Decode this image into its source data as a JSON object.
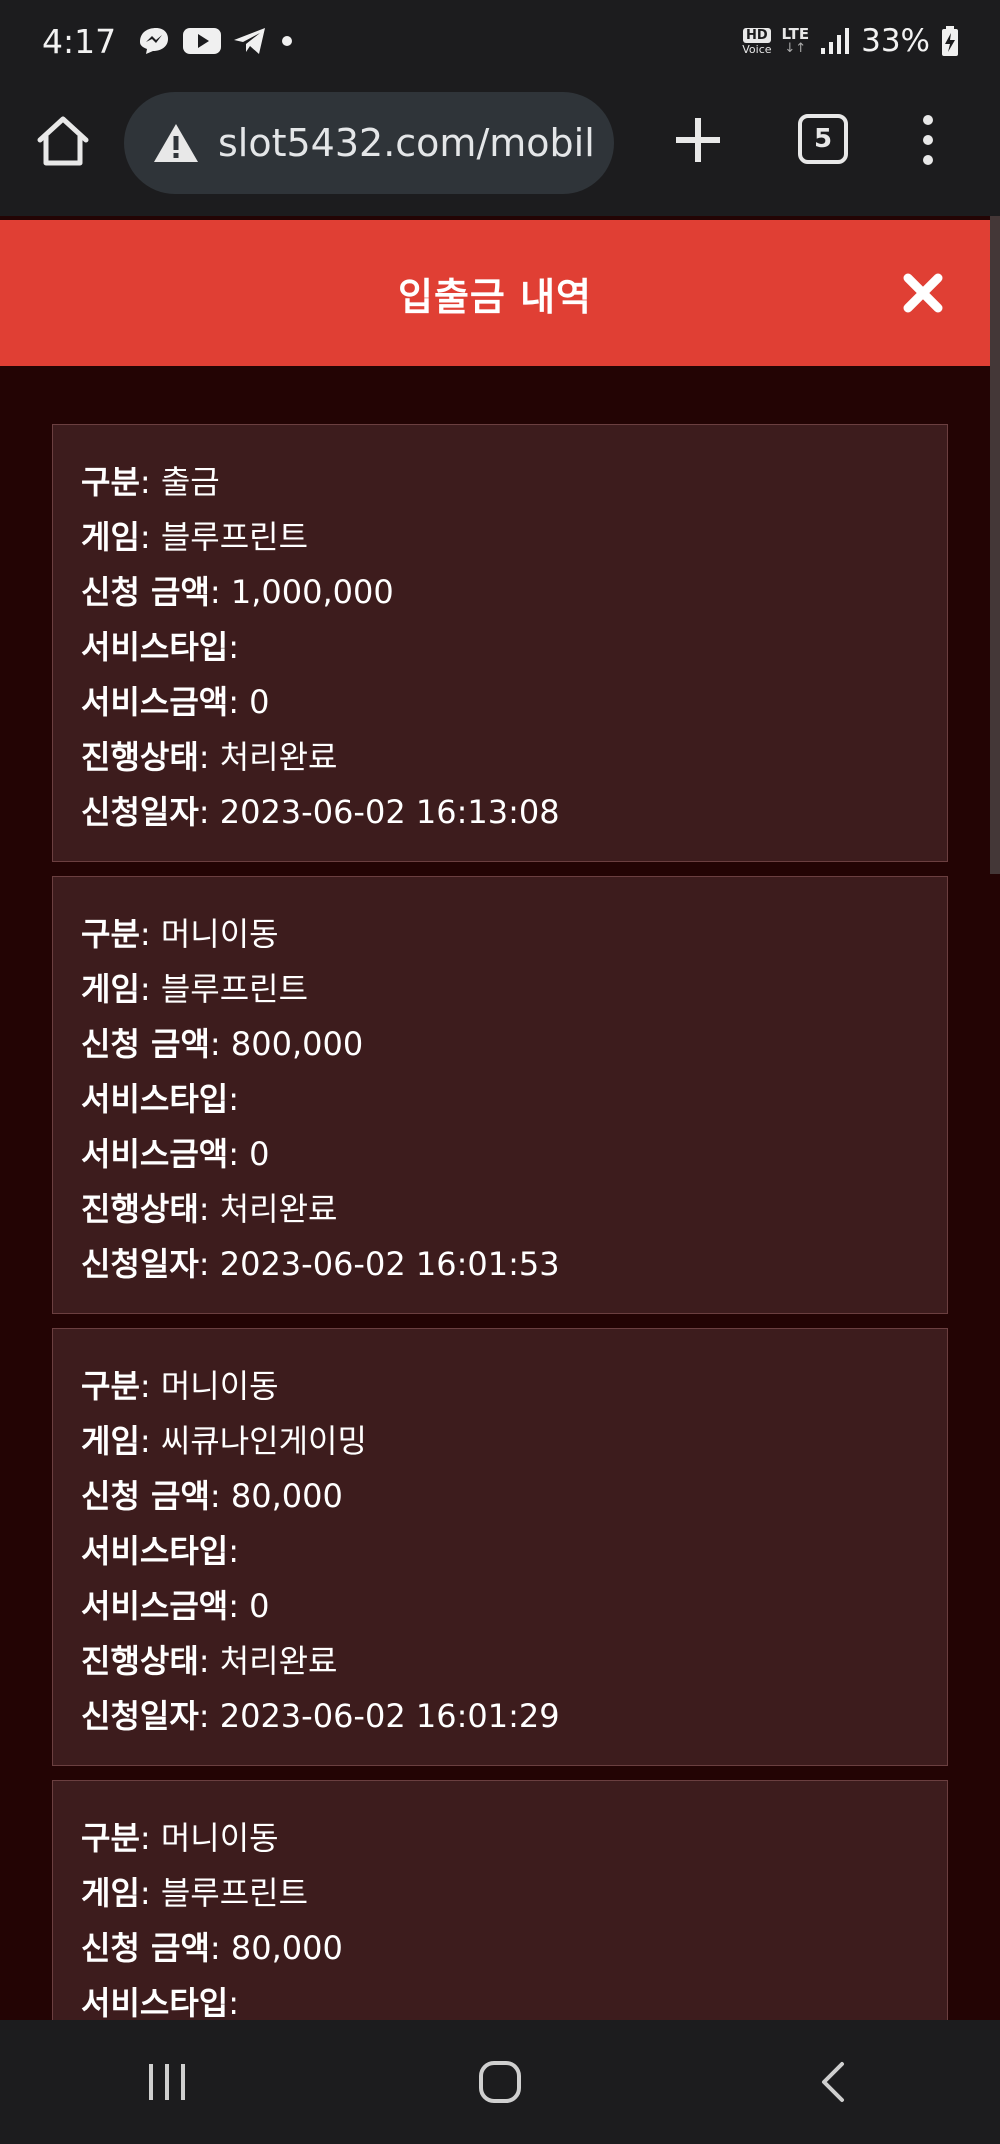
{
  "status_bar": {
    "time": "4:17",
    "hd_label": "HD",
    "voice_label": "Voice",
    "network": "LTE",
    "network_arrows": "↓↑",
    "battery": "33%"
  },
  "browser": {
    "url": "slot5432.com/mobil",
    "tab_count": "5"
  },
  "modal": {
    "title": "입출금 내역"
  },
  "labels": {
    "type": "구분",
    "game": "게임",
    "amount": "신청 금액",
    "service_type": "서비스타입",
    "service_amount": "서비스금액",
    "status": "진행상태",
    "date": "신청일자"
  },
  "records": [
    {
      "type": "출금",
      "game": "블루프린트",
      "amount": "1,000,000",
      "service_type": "",
      "service_amount": "0",
      "status": "처리완료",
      "date": "2023-06-02 16:13:08"
    },
    {
      "type": "머니이동",
      "game": "블루프린트",
      "amount": "800,000",
      "service_type": "",
      "service_amount": "0",
      "status": "처리완료",
      "date": "2023-06-02 16:01:53"
    },
    {
      "type": "머니이동",
      "game": "씨큐나인게이밍",
      "amount": "80,000",
      "service_type": "",
      "service_amount": "0",
      "status": "처리완료",
      "date": "2023-06-02 16:01:29"
    },
    {
      "type": "머니이동",
      "game": "블루프린트",
      "amount": "80,000",
      "service_type": "",
      "service_amount": "",
      "status": "",
      "date": ""
    }
  ]
}
